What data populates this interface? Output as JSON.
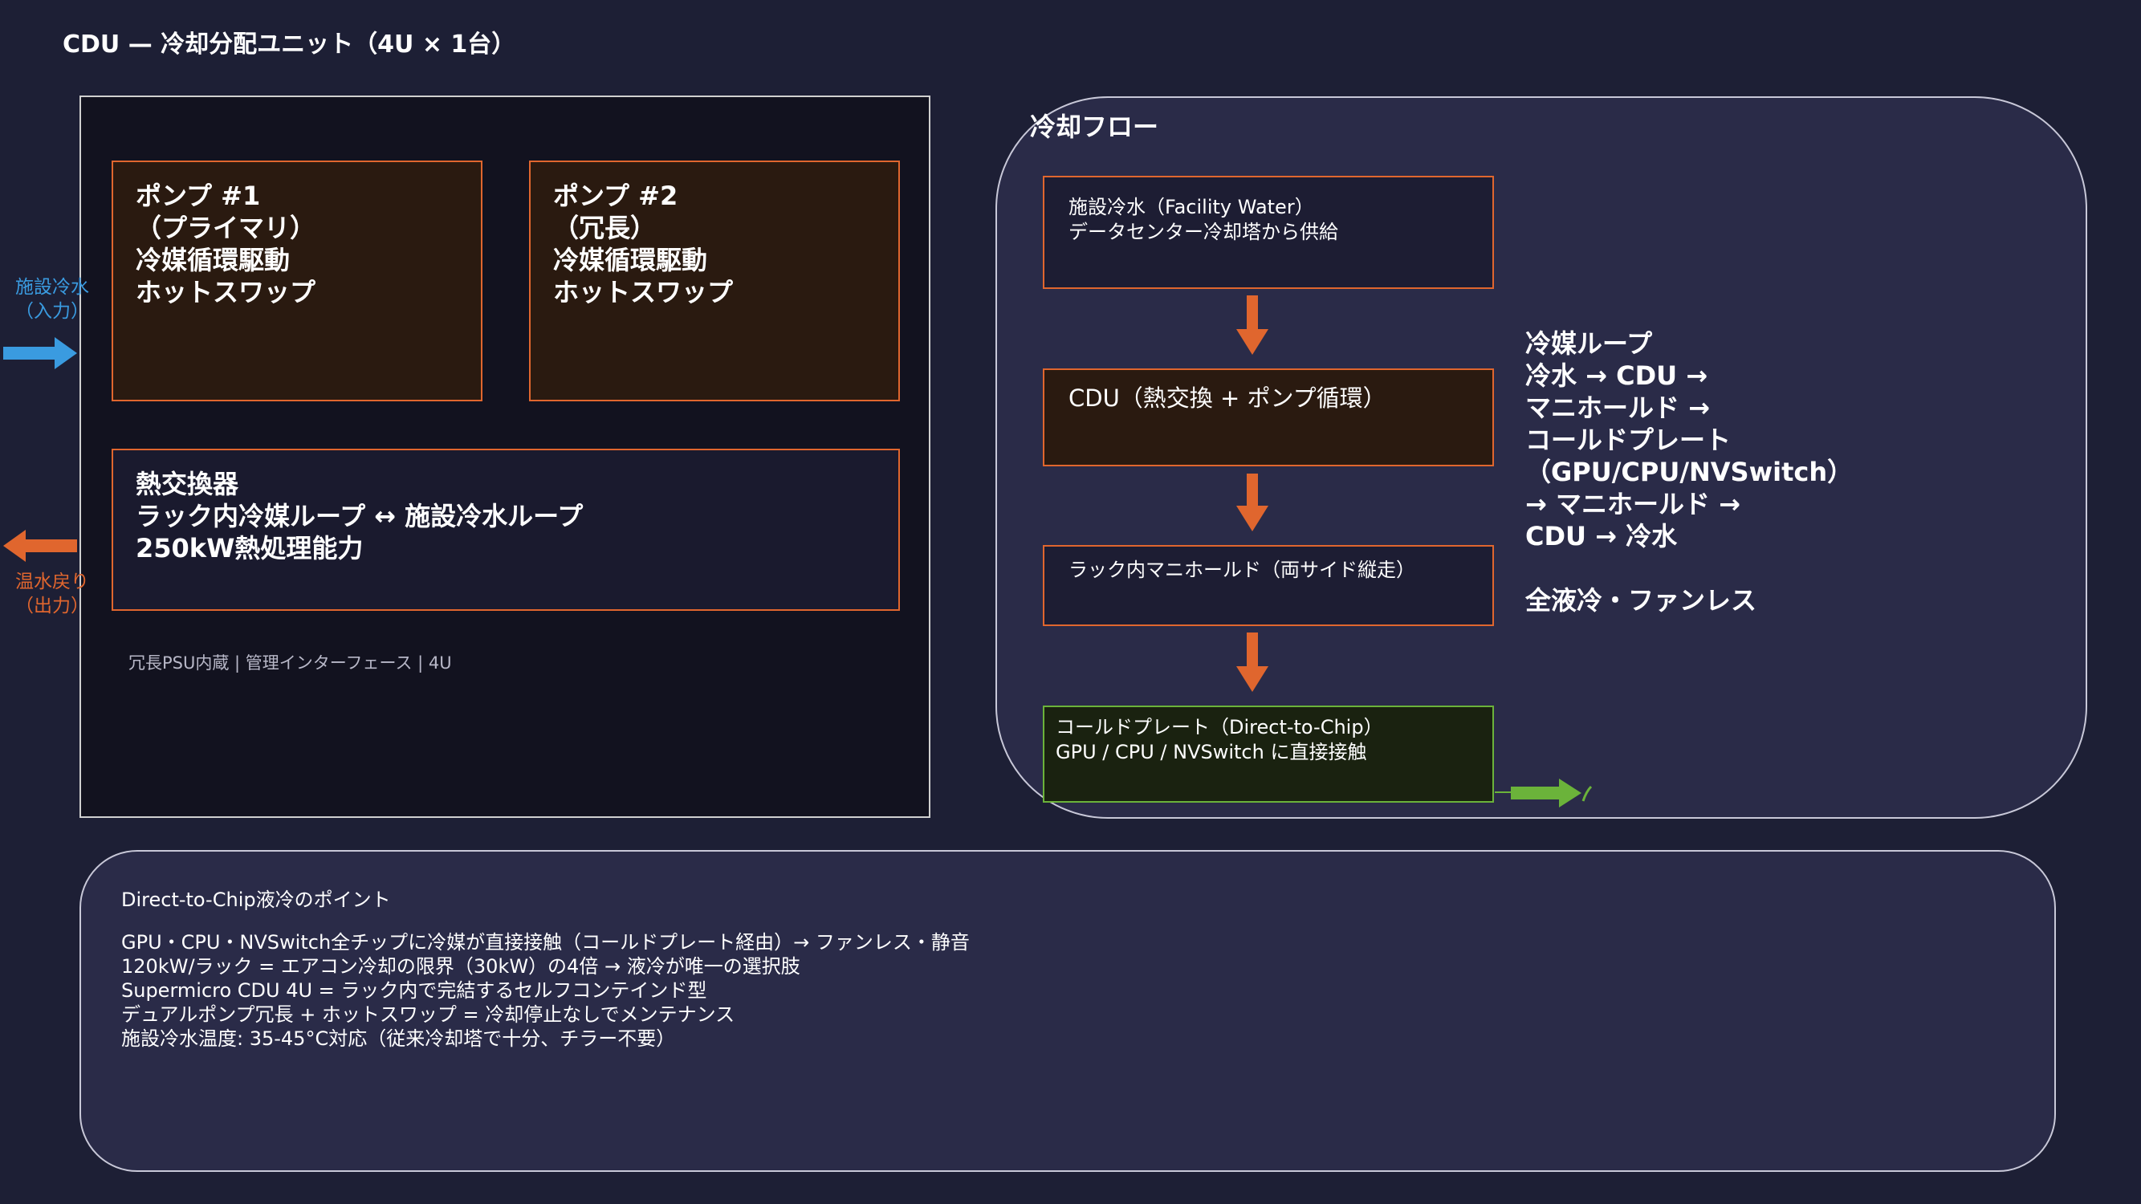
{
  "title": "CDU — 冷却分配ユニット（4U × 1台）",
  "cdu": {
    "pump1_text": "ポンプ #1\n（プライマリ）\n冷媒循環駆動\nホットスワップ",
    "pump2_text": "ポンプ #2\n（冗長）\n冷媒循環駆動\nホットスワップ",
    "heat_exchanger_text": "熱交換器\nラック内冷媒ループ ↔ 施設冷水ループ\n250kW熱処理能力",
    "footer": "冗長PSU内蔵 | 管理インターフェース | 4U",
    "inlet_label": "施設冷水\n（入力）",
    "outlet_label": "温水戻り\n（出力）"
  },
  "flow": {
    "title": "冷却フロー",
    "steps": [
      "施設冷水（Facility Water）\nデータセンター冷却塔から供給",
      "CDU（熱交換 + ポンプ循環）",
      "ラック内マニホールド（両サイド縦走）",
      "コールドプレート（Direct-to-Chip）\nGPU / CPU / NVSwitch に直接接触"
    ],
    "loop_note": "冷媒ループ\n冷水 → CDU →\nマニホールド →\nコールドプレート\n（GPU/CPU/NVSwitch）\n→ マニホールド →\nCDU → 冷水\n\n全液冷・ファンレス"
  },
  "points": {
    "title": "Direct-to-Chip液冷のポイント",
    "lines": [
      "GPU・CPU・NVSwitch全チップに冷媒が直接接触（コールドプレート経由）→ ファンレス・静音",
      "120kW/ラック = エアコン冷却の限界（30kW）の4倍 → 液冷が唯一の選択肢",
      "Supermicro CDU 4U = ラック内で完結するセルフコンテインド型",
      "デュアルポンプ冗長 + ホットスワップ = 冷却停止なしでメンテナンス",
      "施設冷水温度: 35-45°C対応（従来冷却塔で十分、チラー不要）"
    ]
  },
  "colors": {
    "accent_orange": "#e0662e",
    "inlet_blue": "#3a9be0",
    "green": "#6bb33a"
  }
}
